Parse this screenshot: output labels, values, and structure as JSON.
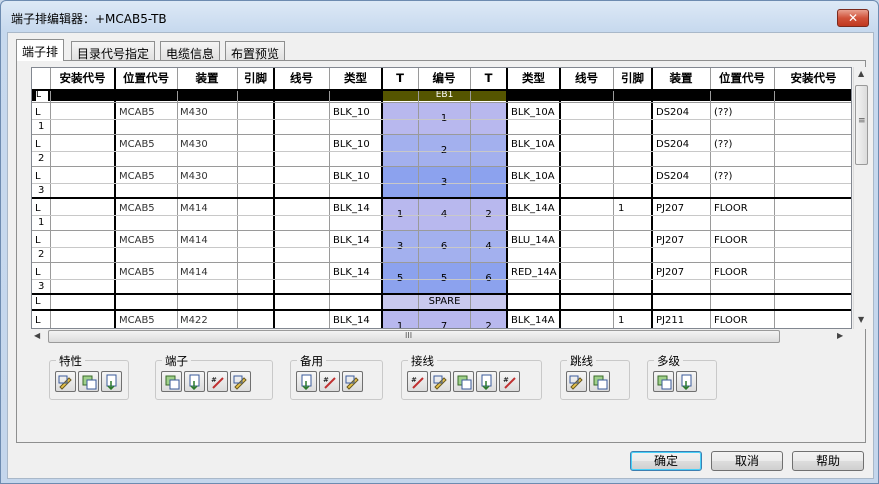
{
  "window": {
    "title": "端子排编辑器：+MCAB5-TB",
    "close": "✕"
  },
  "tabs": [
    "端子排",
    "目录代号指定",
    "电缆信息",
    "布置预览"
  ],
  "columns": [
    "",
    "安装代号",
    "位置代号",
    "装置",
    "引脚",
    "线号",
    "类型",
    "T",
    "编号",
    "T",
    "类型",
    "线号",
    "引脚",
    "装置",
    "位置代号",
    "安装代号"
  ],
  "strip_header": {
    "prefix": "L",
    "label": "EB1"
  },
  "rows": [
    {
      "a": [
        "L",
        "1"
      ],
      "loc": "MCAB5",
      "dev": "M430",
      "type": "BLK_10",
      "t1": "",
      "num": "1",
      "t2": "",
      "rtype": "BLK_10A",
      "rpin": "",
      "rdev": "DS204",
      "rloc": "(??)",
      "band": 1
    },
    {
      "a": [
        "L",
        "2"
      ],
      "loc": "MCAB5",
      "dev": "M430",
      "type": "BLK_10",
      "t1": "",
      "num": "2",
      "t2": "",
      "rtype": "BLK_10A",
      "rpin": "",
      "rdev": "DS204",
      "rloc": "(??)",
      "band": 2
    },
    {
      "a": [
        "L",
        "3"
      ],
      "loc": "MCAB5",
      "dev": "M430",
      "type": "BLK_10",
      "t1": "",
      "num": "3",
      "t2": "",
      "rtype": "BLK_10A",
      "rpin": "",
      "rdev": "DS204",
      "rloc": "(??)",
      "band": 3
    },
    {
      "a": [
        "L",
        "1"
      ],
      "loc": "MCAB5",
      "dev": "M414",
      "type": "BLK_14",
      "t1": "1",
      "num": "4",
      "t2": "2",
      "rtype": "BLK_14A",
      "rpin": "1",
      "rdev": "PJ207",
      "rloc": "FLOOR",
      "band": 1
    },
    {
      "a": [
        "L",
        "2"
      ],
      "loc": "MCAB5",
      "dev": "M414",
      "type": "BLK_14",
      "t1": "3",
      "num": "6",
      "t2": "4",
      "rtype": "BLU_14A",
      "rpin": "",
      "rdev": "PJ207",
      "rloc": "FLOOR",
      "band": 2
    },
    {
      "a": [
        "L",
        "3"
      ],
      "loc": "MCAB5",
      "dev": "M414",
      "type": "BLK_14",
      "t1": "5",
      "num": "5",
      "t2": "6",
      "rtype": "RED_14A",
      "rpin": "",
      "rdev": "PJ207",
      "rloc": "FLOOR",
      "band": 3
    }
  ],
  "spare": {
    "prefix": "L",
    "label": "SPARE"
  },
  "partial_row": {
    "a": [
      "L",
      ""
    ],
    "loc": "MCAB5",
    "dev": "M422",
    "type": "BLK_14",
    "t1": "1",
    "num": "7",
    "t2": "2",
    "rtype": "BLK_14A",
    "rpin": "1",
    "rdev": "PJ211",
    "rloc": "FLOOR"
  },
  "scroll": {
    "up": "▲",
    "down": "▼",
    "left": "◀",
    "right": "▶",
    "grip_v": "≡",
    "grip_h": "III"
  },
  "toolbar_groups": [
    {
      "label": "特性",
      "icons": [
        "edit-properties-icon",
        "copy-properties-icon",
        "paste-properties-icon"
      ]
    },
    {
      "label": "端子",
      "icons": [
        "edit-terminal-icon",
        "reverse-terminal-icon",
        "move-terminal-icon",
        "rotate-terminal-icon"
      ]
    },
    {
      "label": "备用",
      "icons": [
        "insert-spare-icon",
        "delete-spare-icon",
        "add-spare-icon"
      ]
    },
    {
      "label": "接线",
      "icons": [
        "wire-insert-icon",
        "wire-move-up-icon",
        "wire-move-left-icon",
        "wire-move-down-icon",
        "wire-delete-icon"
      ]
    },
    {
      "label": "跳线",
      "icons": [
        "jumper-add-icon",
        "jumper-edit-icon"
      ]
    },
    {
      "label": "多级",
      "icons": [
        "multilevel-add-icon",
        "multilevel-edit-icon"
      ]
    }
  ],
  "buttons": {
    "ok": "确定",
    "cancel": "取消",
    "help": "帮助"
  },
  "colors": {
    "terminal_band_1": "#b8b8ee",
    "terminal_band_2": "#a3b0ee",
    "terminal_band_3": "#8ca2ee",
    "strip_header": "#555500",
    "spare": "#c9c9ee"
  }
}
